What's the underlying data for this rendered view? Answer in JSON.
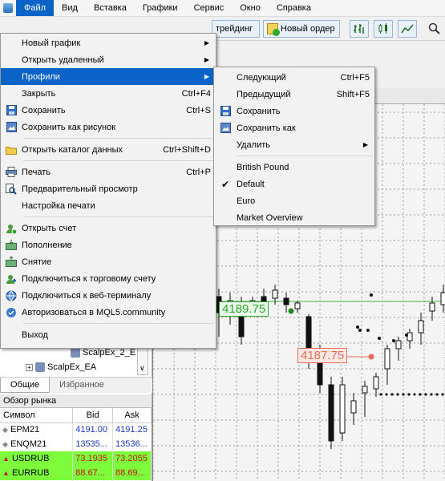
{
  "menubar": {
    "items": [
      "Файл",
      "Вид",
      "Вставка",
      "Графики",
      "Сервис",
      "Окно",
      "Справка"
    ]
  },
  "toolbar": {
    "trading_label": "трейдинг",
    "new_order_label": "Новый ордер"
  },
  "file_menu": {
    "items": [
      {
        "label": "Новый график",
        "shortcut": "",
        "submenu": true
      },
      {
        "label": "Открыть удаленный",
        "shortcut": "",
        "submenu": true
      },
      {
        "label": "Профили",
        "shortcut": "",
        "submenu": true
      },
      {
        "label": "Закрыть",
        "shortcut": "Ctrl+F4"
      },
      {
        "label": "Сохранить",
        "shortcut": "Ctrl+S"
      },
      {
        "label": "Сохранить как рисунок",
        "shortcut": ""
      },
      {
        "label": "Открыть каталог данных",
        "shortcut": "Ctrl+Shift+D"
      },
      {
        "label": "Печать",
        "shortcut": "Ctrl+P"
      },
      {
        "label": "Предварительный просмотр",
        "shortcut": ""
      },
      {
        "label": "Настройка печати",
        "shortcut": ""
      },
      {
        "label": "Открыть счет",
        "shortcut": ""
      },
      {
        "label": "Пополнение",
        "shortcut": ""
      },
      {
        "label": "Снятие",
        "shortcut": ""
      },
      {
        "label": "Подключиться к торговому счету",
        "shortcut": ""
      },
      {
        "label": "Подключиться к веб-терминалу",
        "shortcut": ""
      },
      {
        "label": "Авторизоваться в MQL5.community",
        "shortcut": ""
      },
      {
        "label": "Выход",
        "shortcut": ""
      }
    ]
  },
  "profiles_menu": {
    "items": [
      {
        "label": "Следующий",
        "shortcut": "Ctrl+F5"
      },
      {
        "label": "Предыдущий",
        "shortcut": "Shift+F5"
      },
      {
        "label": "Сохранить",
        "shortcut": ""
      },
      {
        "label": "Сохранить как",
        "shortcut": ""
      },
      {
        "label": "Удалить",
        "shortcut": "",
        "submenu": true
      },
      {
        "label": "British Pound",
        "shortcut": ""
      },
      {
        "label": "Default",
        "shortcut": "",
        "checked": true
      },
      {
        "label": "Euro",
        "shortcut": ""
      },
      {
        "label": "Market Overview",
        "shortcut": ""
      }
    ]
  },
  "navigator": {
    "items": [
      "ScalpEx_2_E",
      "ScalpEx_EA"
    ],
    "tabs": [
      "Общие",
      "Избранное"
    ]
  },
  "chart": {
    "price_label_green": "4189.75",
    "price_label_red": "4187.75"
  },
  "market_watch": {
    "title": "Обзор рынка",
    "columns": [
      "Символ",
      "Bid",
      "Ask"
    ],
    "rows": [
      {
        "symbol": "EPM21",
        "bid": "4191.00",
        "ask": "4191.25",
        "highlight": false
      },
      {
        "symbol": "ENQM21",
        "bid": "13535...",
        "ask": "13536...",
        "highlight": false
      },
      {
        "symbol": "USDRUB",
        "bid": "73.1935",
        "ask": "73.2055",
        "highlight": true
      },
      {
        "symbol": "EURRUB",
        "bid": "88.67...",
        "ask": "88.69...",
        "highlight": true
      }
    ]
  },
  "colors": {
    "accent": "#0a64c8",
    "highlight_row": "#7cfc3a",
    "bid_color": "#1a3cc8"
  }
}
